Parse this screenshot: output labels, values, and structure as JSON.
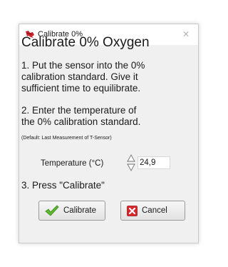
{
  "window": {
    "title": "Calibrate 0%",
    "close_glyph": "✕"
  },
  "content": {
    "heading": "Calibrate 0% Oxygen",
    "step1_lines": [
      "1. Put the sensor into the 0%",
      "calibration standard. Give it",
      "sufficient time to equilibrate."
    ],
    "step2_lines": [
      "2. Enter the temperature of",
      "the 0% calibration standard."
    ],
    "default_note": "(Default: Last Measurement of T-Sensor)",
    "temperature": {
      "label": "Temperature (°C)",
      "value": "24,9"
    },
    "step3": "3. Press \"Calibrate\""
  },
  "buttons": {
    "calibrate": {
      "label": "Calibrate",
      "icon": "green-checkmark-icon"
    },
    "cancel": {
      "label": "Cancel",
      "icon": "red-x-icon"
    }
  },
  "colors": {
    "check_green": "#5cb82e",
    "cancel_red": "#d9262b",
    "app_icon_red": "#c8252c"
  }
}
